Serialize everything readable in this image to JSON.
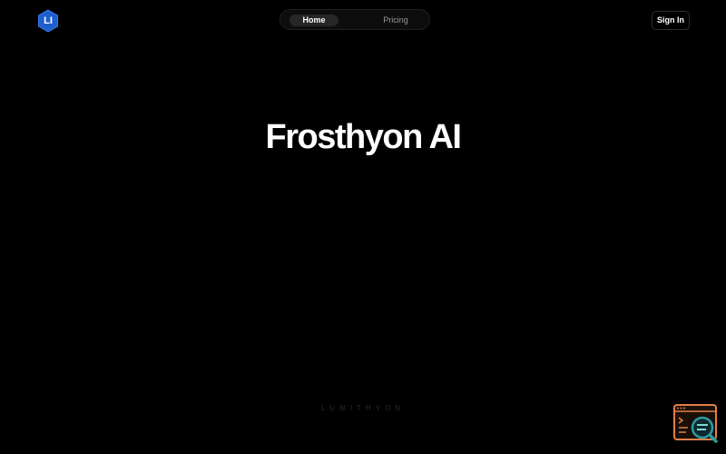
{
  "brand": {
    "logo_text": "LI",
    "logo_color": "#1e5fd0"
  },
  "nav": {
    "items": [
      {
        "label": "Home",
        "active": true
      },
      {
        "label": "Pricing",
        "active": false
      }
    ]
  },
  "header": {
    "signin_label": "Sign In"
  },
  "hero": {
    "title": "Frosthyon AI"
  },
  "footer": {
    "wordmark": "LUMITHYON"
  },
  "widget": {
    "icon": "terminal-search-icon",
    "frame_color": "#e0814a",
    "lens_color": "#2e9aa0"
  }
}
